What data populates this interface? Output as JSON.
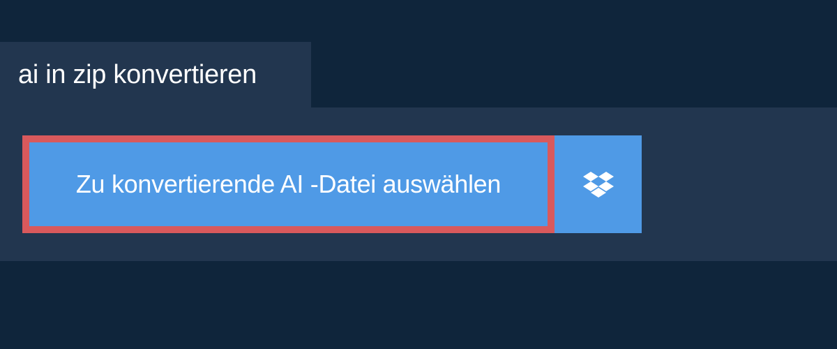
{
  "tab": {
    "title": "ai in zip konvertieren"
  },
  "converter": {
    "select_file_label": "Zu konvertierende AI -Datei auswählen",
    "dropbox_icon": "dropbox-icon"
  },
  "colors": {
    "background": "#0f253b",
    "panel": "#22364f",
    "button": "#4f9ae6",
    "focus_border": "#d9595c",
    "text": "#ffffff"
  }
}
